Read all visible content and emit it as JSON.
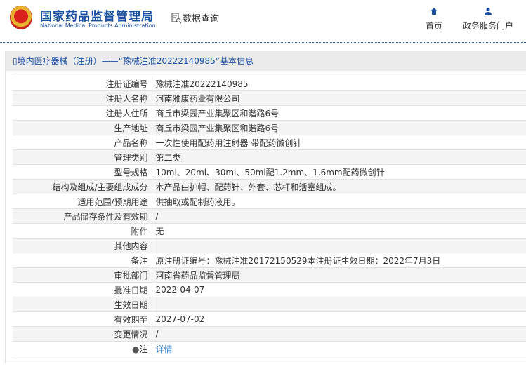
{
  "header": {
    "logo_cn": "国家药品监督管理局",
    "logo_en": "National Medical Products Administration",
    "section": "数据查询",
    "nav": [
      {
        "label": "首页",
        "icon": "home-icon"
      },
      {
        "label": "政务服务门户",
        "icon": "user-icon"
      }
    ]
  },
  "panel": {
    "title": "境内医疗器械（注册）——“豫械注准20222140985”基本信息"
  },
  "rows": [
    {
      "k": "注册证编号",
      "v": "豫械注准20222140985"
    },
    {
      "k": "注册人名称",
      "v": "河南雅康药业有限公司"
    },
    {
      "k": "注册人住所",
      "v": "商丘市梁园产业集聚区和谐路6号"
    },
    {
      "k": "生产地址",
      "v": "商丘市梁园产业集聚区和谐路6号"
    },
    {
      "k": "产品名称",
      "v": "一次性使用配药用注射器 带配药微创针"
    },
    {
      "k": "管理类别",
      "v": "第二类"
    },
    {
      "k": "型号规格",
      "v": "10ml、20ml、30ml、50ml配1.2mm、1.6mm配药微创针"
    },
    {
      "k": "结构及组成/主要组成成分",
      "v": "本产品由护帽、配药针、外套、芯杆和活塞组成。"
    },
    {
      "k": "适用范围/预期用途",
      "v": "供抽取或配制药液用。"
    },
    {
      "k": "产品储存条件及有效期",
      "v": "/"
    },
    {
      "k": "附件",
      "v": "无"
    },
    {
      "k": "其他内容",
      "v": ""
    },
    {
      "k": "备注",
      "v": "原注册证编号：豫械注准20172150529本注册证生效日期：2022年7月3日"
    },
    {
      "k": "审批部门",
      "v": "河南省药品监督管理局"
    },
    {
      "k": "批准日期",
      "v": "2022-04-07"
    },
    {
      "k": "生效日期",
      "v": ""
    },
    {
      "k": "有效期至",
      "v": "2027-07-02"
    },
    {
      "k": "变更情况",
      "v": "/"
    }
  ],
  "note": {
    "label": "注",
    "link": "详情"
  }
}
